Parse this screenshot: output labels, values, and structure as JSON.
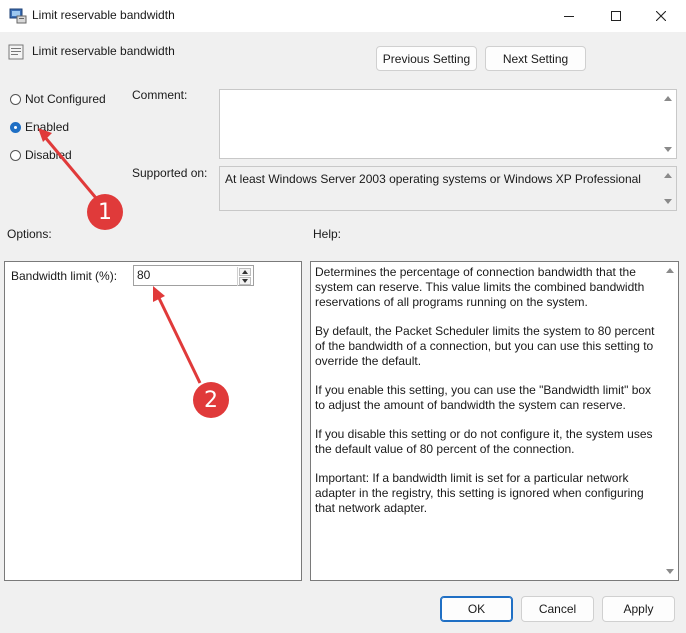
{
  "window": {
    "title": "Limit reservable bandwidth",
    "controls": {
      "minimize_icon": "minimize-icon",
      "maximize_icon": "maximize-icon",
      "close_icon": "close-icon"
    }
  },
  "header": {
    "policy_name": "Limit reservable bandwidth",
    "prev_button": "Previous Setting",
    "next_button": "Next Setting"
  },
  "state": {
    "options": [
      {
        "label": "Not Configured",
        "checked": false
      },
      {
        "label": "Enabled",
        "checked": true
      },
      {
        "label": "Disabled",
        "checked": false
      }
    ]
  },
  "comment": {
    "label": "Comment:",
    "value": ""
  },
  "supported": {
    "label": "Supported on:",
    "value": "At least Windows Server 2003 operating systems or Windows XP Professional"
  },
  "options_panel": {
    "title": "Options:",
    "bandwidth_label": "Bandwidth limit (%):",
    "bandwidth_value": "80"
  },
  "help_panel": {
    "title": "Help:",
    "paragraphs": [
      "Determines the percentage of connection bandwidth that the system can reserve. This value limits the combined bandwidth reservations of all programs running on the system.",
      "By default, the Packet Scheduler limits the system to 80 percent of the bandwidth of a connection, but you can use this setting to override the default.",
      "If you enable this setting, you can use the \"Bandwidth limit\" box to adjust the amount of bandwidth the system can reserve.",
      "If you disable this setting or do not configure it, the system uses the default value of 80 percent of the connection.",
      "Important: If a bandwidth limit is set for a particular network adapter in the registry, this setting is ignored when configuring that network adapter."
    ]
  },
  "footer": {
    "ok": "OK",
    "cancel": "Cancel",
    "apply": "Apply"
  },
  "annotations": [
    {
      "number": "1"
    },
    {
      "number": "2"
    }
  ],
  "colors": {
    "accent": "#1f6fc4",
    "annotation": "#e03a3a"
  }
}
